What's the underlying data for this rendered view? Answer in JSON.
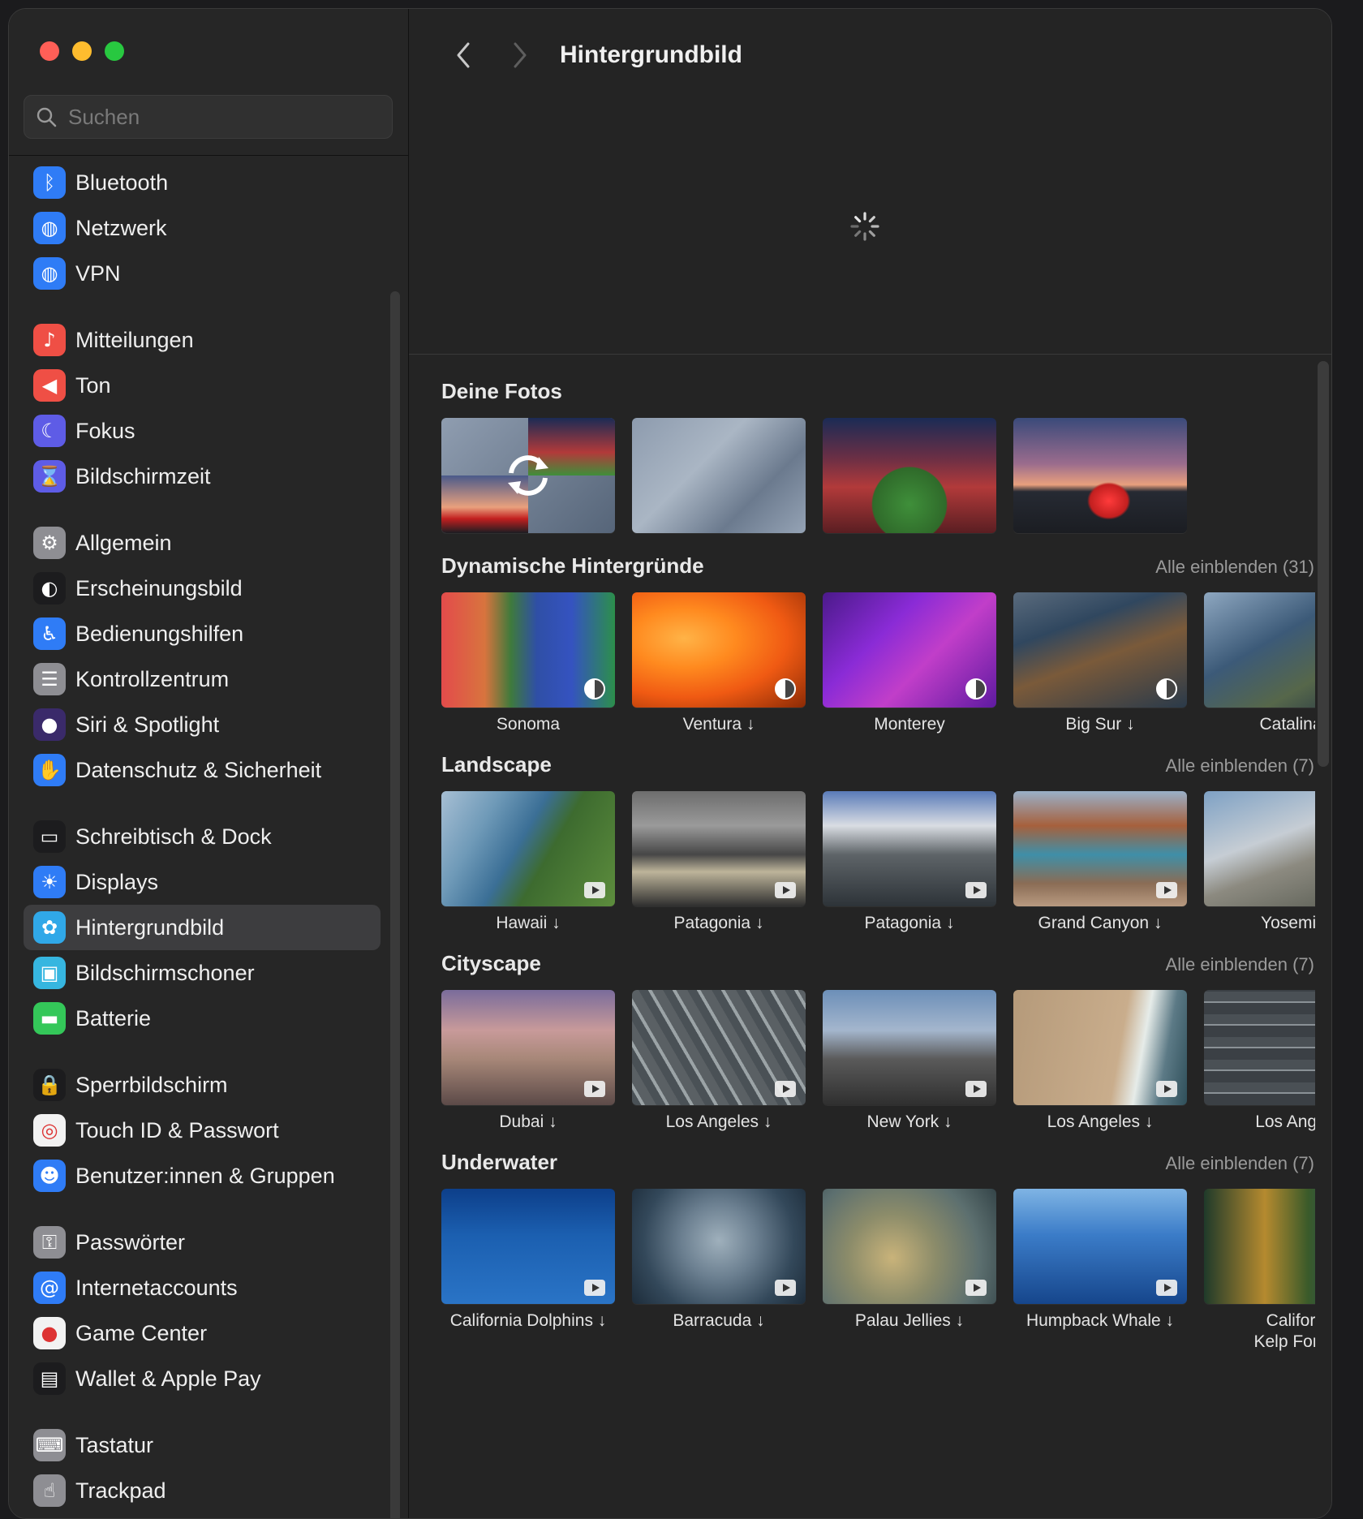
{
  "sidebar": {
    "search_placeholder": "Suchen",
    "groups": [
      [
        {
          "name": "bluetooth",
          "label": "Bluetooth",
          "icon": "bluetooth-icon",
          "glyph": "ᛒ",
          "color": "#2f7cf6"
        },
        {
          "name": "netzwerk",
          "label": "Netzwerk",
          "icon": "globe-icon",
          "glyph": "◍",
          "color": "#2f7cf6"
        },
        {
          "name": "vpn",
          "label": "VPN",
          "icon": "vpn-globe-icon",
          "glyph": "◍",
          "color": "#2f7cf6"
        }
      ],
      [
        {
          "name": "mitteilungen",
          "label": "Mitteilungen",
          "icon": "bell-icon",
          "glyph": "♪",
          "color": "#ef4f45"
        },
        {
          "name": "ton",
          "label": "Ton",
          "icon": "speaker-icon",
          "glyph": "◀",
          "color": "#ef4f45"
        },
        {
          "name": "fokus",
          "label": "Fokus",
          "icon": "moon-icon",
          "glyph": "☾",
          "color": "#5e5ce6"
        },
        {
          "name": "bildschirmzeit",
          "label": "Bildschirmzeit",
          "icon": "hourglass-icon",
          "glyph": "⌛",
          "color": "#5e5ce6"
        }
      ],
      [
        {
          "name": "allgemein",
          "label": "Allgemein",
          "icon": "gear-icon",
          "glyph": "⚙",
          "color": "#8e8e93"
        },
        {
          "name": "erscheinungsbild",
          "label": "Erscheinungsbild",
          "icon": "appearance-icon",
          "glyph": "◐",
          "color": "#1c1c1e"
        },
        {
          "name": "bedienungshilfen",
          "label": "Bedienungshilfen",
          "icon": "accessibility-icon",
          "glyph": "♿",
          "color": "#2f7cf6"
        },
        {
          "name": "kontrollzentrum",
          "label": "Kontrollzentrum",
          "icon": "toggles-icon",
          "glyph": "☰",
          "color": "#8e8e93"
        },
        {
          "name": "siri-spotlight",
          "label": "Siri & Spotlight",
          "icon": "siri-icon",
          "glyph": "●",
          "color": "#3a2a6a"
        },
        {
          "name": "datenschutz",
          "label": "Datenschutz & Sicherheit",
          "icon": "hand-icon",
          "glyph": "✋",
          "color": "#2f7cf6"
        }
      ],
      [
        {
          "name": "schreibtisch-dock",
          "label": "Schreibtisch & Dock",
          "icon": "dock-icon",
          "glyph": "▭",
          "color": "#1c1c1e"
        },
        {
          "name": "displays",
          "label": "Displays",
          "icon": "sun-icon",
          "glyph": "☀",
          "color": "#2f7cf6"
        },
        {
          "name": "hintergrundbild",
          "label": "Hintergrundbild",
          "icon": "flower-icon",
          "glyph": "✿",
          "color": "#30a8e8",
          "active": true
        },
        {
          "name": "bildschirmschoner",
          "label": "Bildschirmschoner",
          "icon": "screensaver-icon",
          "glyph": "▣",
          "color": "#36b6e0"
        },
        {
          "name": "batterie",
          "label": "Batterie",
          "icon": "battery-icon",
          "glyph": "▬",
          "color": "#34c759"
        }
      ],
      [
        {
          "name": "sperrbildschirm",
          "label": "Sperrbildschirm",
          "icon": "lock-icon",
          "glyph": "🔒",
          "color": "#1c1c1e"
        },
        {
          "name": "touch-id",
          "label": "Touch ID & Passwort",
          "icon": "fingerprint-icon",
          "glyph": "◎",
          "color": "#f2f2f2"
        },
        {
          "name": "benutzer",
          "label": "Benutzer:innen & Gruppen",
          "icon": "users-icon",
          "glyph": "☻",
          "color": "#2f7cf6"
        }
      ],
      [
        {
          "name": "passwoerter",
          "label": "Passwörter",
          "icon": "key-icon",
          "glyph": "⚿",
          "color": "#8e8e93"
        },
        {
          "name": "internetaccounts",
          "label": "Internetaccounts",
          "icon": "at-icon",
          "glyph": "@",
          "color": "#2f7cf6"
        },
        {
          "name": "game-center",
          "label": "Game Center",
          "icon": "gamecenter-icon",
          "glyph": "●",
          "color": "#f2f2f2"
        },
        {
          "name": "wallet",
          "label": "Wallet & Apple Pay",
          "icon": "wallet-icon",
          "glyph": "▤",
          "color": "#1c1c1e"
        }
      ],
      [
        {
          "name": "tastatur",
          "label": "Tastatur",
          "icon": "keyboard-icon",
          "glyph": "⌨",
          "color": "#8e8e93"
        },
        {
          "name": "trackpad",
          "label": "Trackpad",
          "icon": "trackpad-icon",
          "glyph": "☝",
          "color": "#8e8e93"
        }
      ]
    ]
  },
  "header": {
    "title": "Hintergrundbild"
  },
  "sections": [
    {
      "name": "deine-fotos",
      "title": "Deine Fotos",
      "more": "",
      "tiles": [
        {
          "name": "photo-shuffle",
          "label": "",
          "style": "shuffle"
        },
        {
          "name": "photo-grey",
          "label": "",
          "style": "grey"
        },
        {
          "name": "photo-stadium-inside",
          "label": "",
          "style": "stadium"
        },
        {
          "name": "photo-stadium-dusk",
          "label": "",
          "style": "dusk"
        }
      ]
    },
    {
      "name": "dynamische-hintergruende",
      "title": "Dynamische Hintergründe",
      "more": "Alle einblenden (31)",
      "tiles": [
        {
          "name": "sonoma",
          "label": "Sonoma",
          "style": "sonoma",
          "badge": "dynamic"
        },
        {
          "name": "ventura",
          "label": "Ventura ↓",
          "style": "ventura",
          "badge": "dynamic"
        },
        {
          "name": "monterey",
          "label": "Monterey",
          "style": "monterey",
          "badge": "dynamic"
        },
        {
          "name": "big-sur",
          "label": "Big Sur ↓",
          "style": "bigsur",
          "badge": "dynamic"
        },
        {
          "name": "catalina",
          "label": "Catalina",
          "style": "catalina",
          "badge": ""
        }
      ]
    },
    {
      "name": "landscape",
      "title": "Landscape",
      "more": "Alle einblenden (7)",
      "tiles": [
        {
          "name": "hawaii",
          "label": "Hawaii ↓",
          "style": "hawaii",
          "badge": "video"
        },
        {
          "name": "patagonia-1",
          "label": "Patagonia ↓",
          "style": "patagonia1",
          "badge": "video"
        },
        {
          "name": "patagonia-2",
          "label": "Patagonia ↓",
          "style": "patagonia2",
          "badge": "video"
        },
        {
          "name": "grand-canyon",
          "label": "Grand Canyon ↓",
          "style": "canyon",
          "badge": "video"
        },
        {
          "name": "yosemite",
          "label": "Yosemit",
          "style": "yosemite",
          "badge": ""
        }
      ]
    },
    {
      "name": "cityscape",
      "title": "Cityscape",
      "more": "Alle einblenden (7)",
      "tiles": [
        {
          "name": "dubai",
          "label": "Dubai ↓",
          "style": "dubai",
          "badge": "video"
        },
        {
          "name": "los-angeles-1",
          "label": "Los Angeles ↓",
          "style": "la1",
          "badge": "video"
        },
        {
          "name": "new-york",
          "label": "New York ↓",
          "style": "ny",
          "badge": "video"
        },
        {
          "name": "los-angeles-2",
          "label": "Los Angeles ↓",
          "style": "la2",
          "badge": "video"
        },
        {
          "name": "los-angeles-3",
          "label": "Los Ange",
          "style": "la3",
          "badge": ""
        }
      ]
    },
    {
      "name": "underwater",
      "title": "Underwater",
      "more": "Alle einblenden (7)",
      "tiles": [
        {
          "name": "california-dolphins",
          "label": "California Dolphins ↓",
          "style": "dolphins",
          "badge": "video"
        },
        {
          "name": "barracuda",
          "label": "Barracuda ↓",
          "style": "barracuda",
          "badge": "video"
        },
        {
          "name": "palau-jellies",
          "label": "Palau Jellies ↓",
          "style": "jellies",
          "badge": "video"
        },
        {
          "name": "humpback-whale",
          "label": "Humpback Whale ↓",
          "style": "whale",
          "badge": "video"
        },
        {
          "name": "california-kelp",
          "label": "Califor\nKelp Fore",
          "style": "kelp",
          "badge": ""
        }
      ]
    }
  ]
}
